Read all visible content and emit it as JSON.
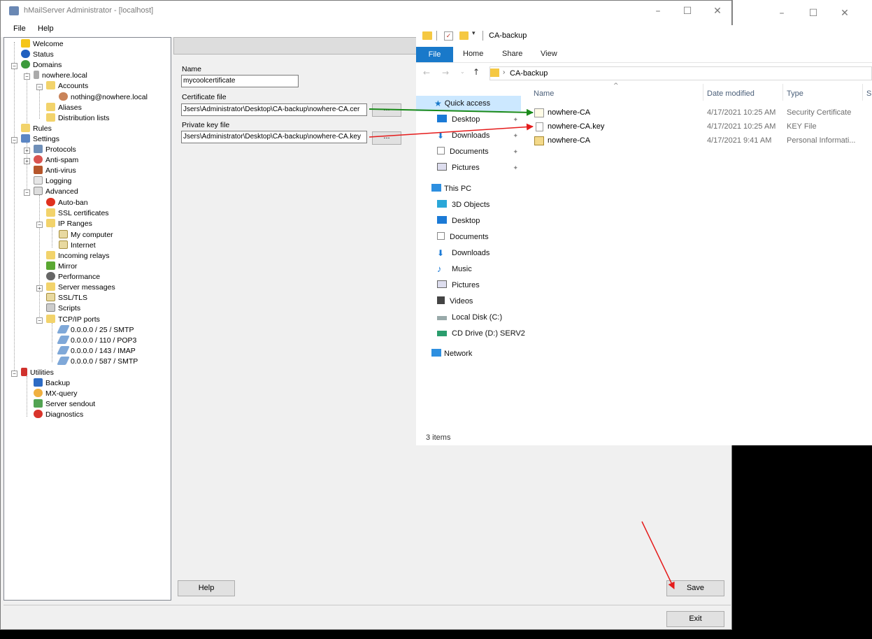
{
  "hms": {
    "title": "hMailServer Administrator - [localhost]",
    "menu": [
      "File",
      "Help"
    ],
    "tree": [
      "Welcome",
      "Status",
      "Domains",
      "nowhere.local",
      "Accounts",
      "nothing@nowhere.local",
      "Aliases",
      "Distribution lists",
      "Rules",
      "Settings",
      "Protocols",
      "Anti-spam",
      "Anti-virus",
      "Logging",
      "Advanced",
      "Auto-ban",
      "SSL certificates",
      "IP Ranges",
      "My computer",
      "Internet",
      "Incoming relays",
      "Mirror",
      "Performance",
      "Server messages",
      "SSL/TLS",
      "Scripts",
      "TCP/IP ports",
      "0.0.0.0 / 25 / SMTP",
      "0.0.0.0 / 110 / POP3",
      "0.0.0.0 / 143 / IMAP",
      "0.0.0.0 / 587 / SMTP",
      "Utilities",
      "Backup",
      "MX-query",
      "Server sendout",
      "Diagnostics"
    ],
    "form": {
      "name_label": "Name",
      "name_value": "mycoolcertificate",
      "cert_label": "Certificate file",
      "cert_value": "Jsers\\Administrator\\Desktop\\CA-backup\\nowhere-CA.cer",
      "key_label": "Private key file",
      "key_value": "Jsers\\Administrator\\Desktop\\CA-backup\\nowhere-CA.key",
      "browse": "..."
    },
    "buttons": {
      "help": "Help",
      "save": "Save",
      "exit": "Exit"
    }
  },
  "explorer": {
    "title": "CA-backup",
    "ribbon": {
      "file": "File",
      "home": "Home",
      "share": "Share",
      "view": "View"
    },
    "address": "CA-backup",
    "nav": {
      "quick_access": "Quick access",
      "quick": [
        "Desktop",
        "Downloads",
        "Documents",
        "Pictures"
      ],
      "this_pc": "This PC",
      "pc": [
        "3D Objects",
        "Desktop",
        "Documents",
        "Downloads",
        "Music",
        "Pictures",
        "Videos",
        "Local Disk (C:)",
        "CD Drive (D:) SERV2"
      ],
      "network": "Network"
    },
    "columns": {
      "name": "Name",
      "date": "Date modified",
      "type": "Type",
      "size": "Si"
    },
    "files": [
      {
        "name": "nowhere-CA",
        "date": "4/17/2021 10:25 AM",
        "type": "Security Certificate"
      },
      {
        "name": "nowhere-CA.key",
        "date": "4/17/2021 10:25 AM",
        "type": "KEY File"
      },
      {
        "name": "nowhere-CA",
        "date": "4/17/2021 9:41 AM",
        "type": "Personal Informati..."
      }
    ],
    "status": "3 items"
  },
  "colors": {
    "accent": "#1979ca",
    "arrow_green": "#1a8a1a",
    "arrow_red": "#e51b1b",
    "selected_nav": "#cce8ff"
  }
}
